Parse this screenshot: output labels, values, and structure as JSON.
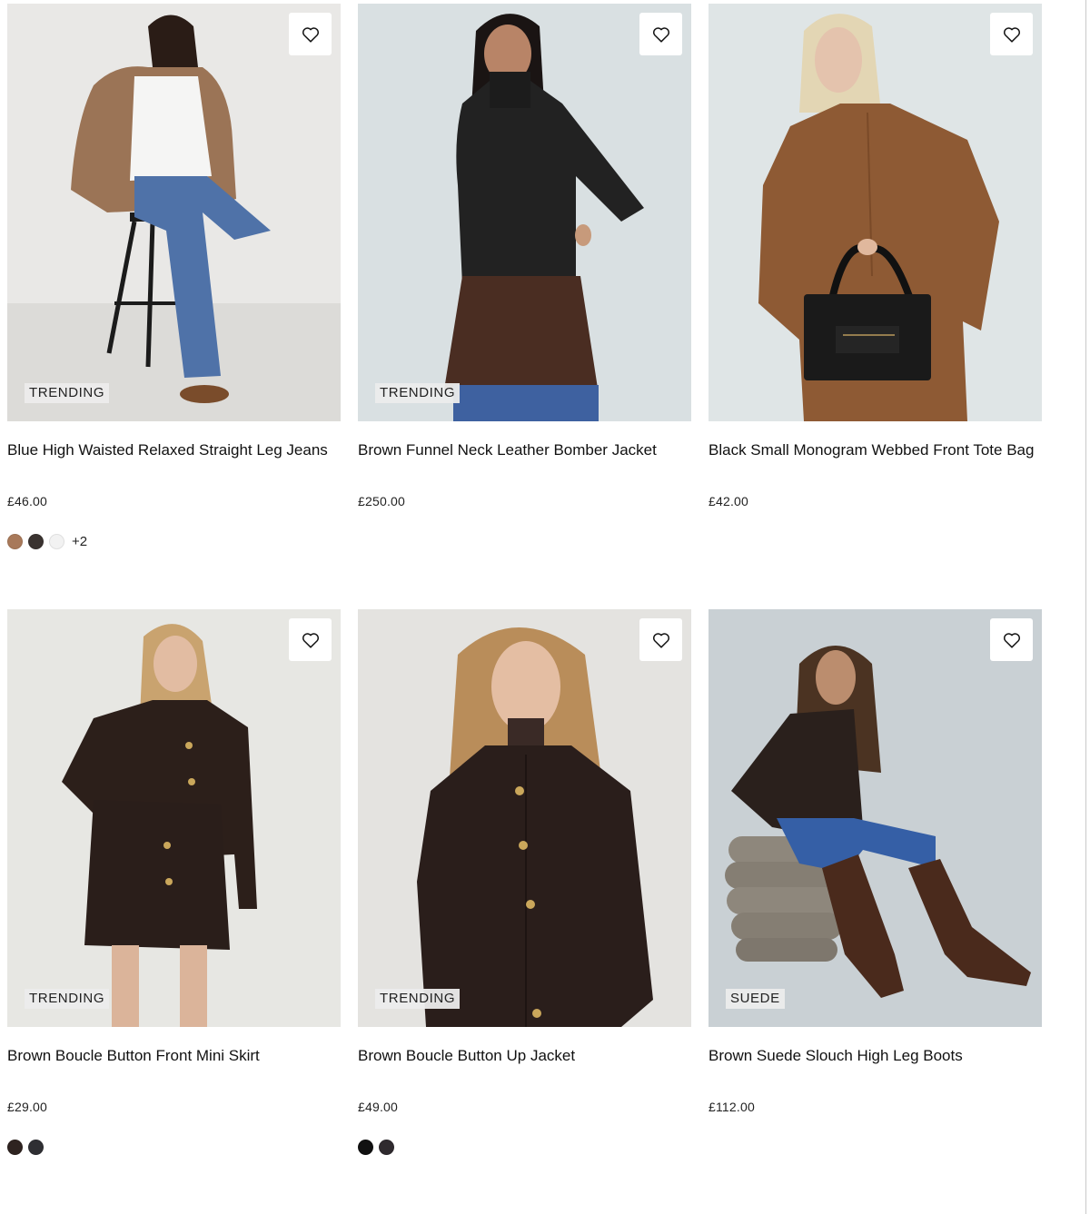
{
  "products": [
    {
      "title": "Blue High Waisted Relaxed Straight Leg Jeans",
      "price": "£46.00",
      "badge": "TRENDING",
      "swatches": [
        "#a8795a",
        "#3a3330",
        "#f2f2f2"
      ],
      "more_colors": "+2",
      "image_bg": "#e9e8e6"
    },
    {
      "title": "Brown Funnel Neck Leather Bomber Jacket",
      "price": "£250.00",
      "badge": "TRENDING",
      "swatches": [],
      "more_colors": "",
      "image_bg": "#d9e0e2"
    },
    {
      "title": "Black Small Monogram Webbed Front Tote Bag",
      "price": "£42.00",
      "badge": "",
      "swatches": [],
      "more_colors": "",
      "image_bg": "#dfe5e6"
    },
    {
      "title": "Brown Boucle Button Front Mini Skirt",
      "price": "£29.00",
      "badge": "TRENDING",
      "swatches": [
        "#2e2320",
        "#2f2f33"
      ],
      "more_colors": "",
      "image_bg": "#e7e7e3"
    },
    {
      "title": "Brown Boucle Button Up Jacket",
      "price": "£49.00",
      "badge": "TRENDING",
      "swatches": [
        "#111111",
        "#2f2a2e"
      ],
      "more_colors": "",
      "image_bg": "#e4e3e0"
    },
    {
      "title": "Brown Suede Slouch High Leg Boots",
      "price": "£112.00",
      "badge": "SUEDE",
      "swatches": [],
      "more_colors": "",
      "image_bg": "#c9d0d4"
    }
  ],
  "icons": {
    "wishlist": "heart-outline-icon"
  }
}
